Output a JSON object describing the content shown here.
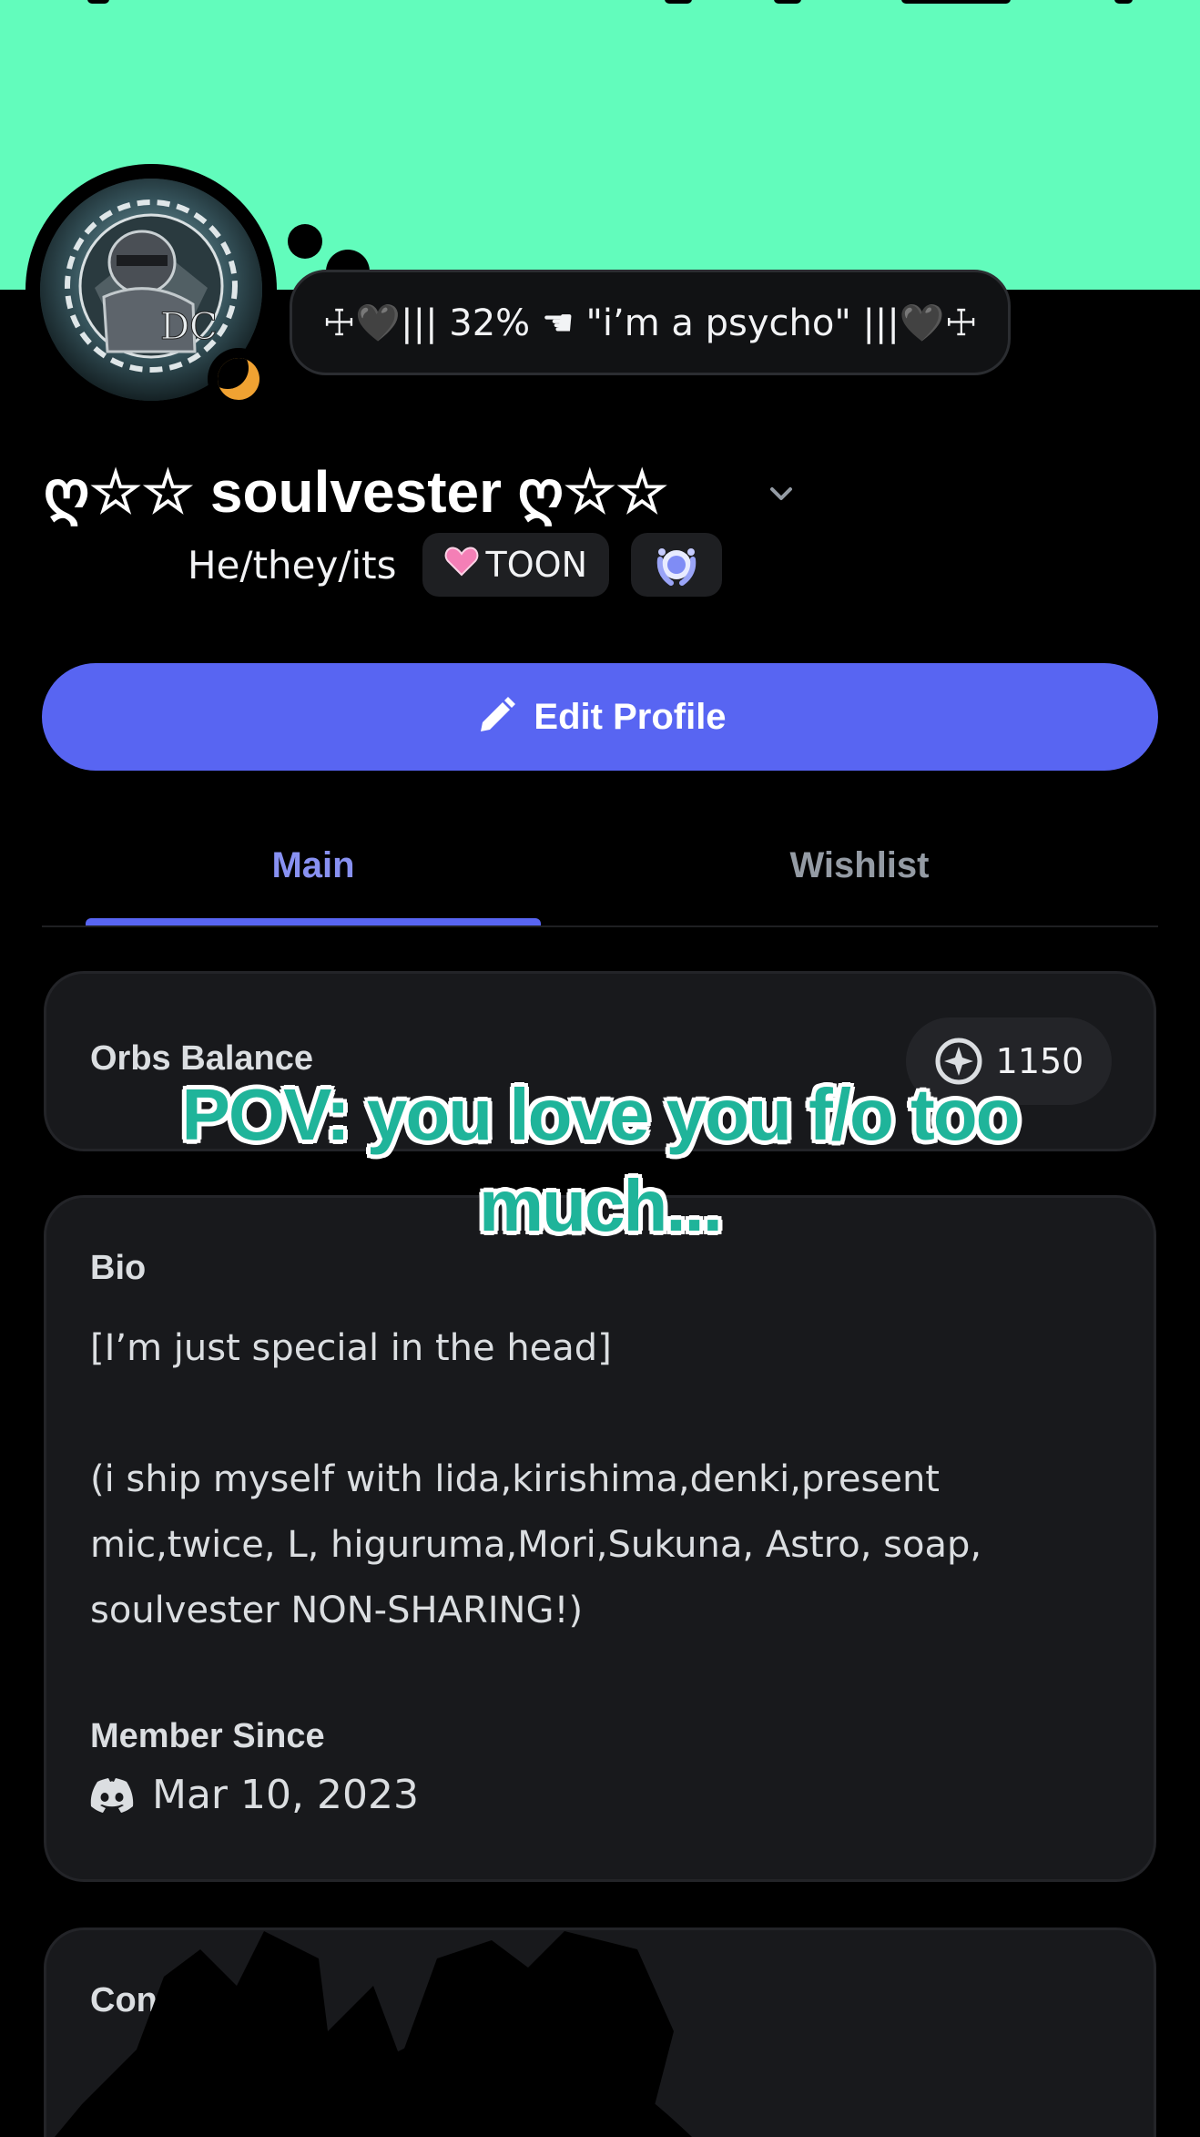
{
  "colors": {
    "banner": "#62fcbc",
    "accent": "#5865f2",
    "tab_active": "#8891f2",
    "caption_fill": "#1fb49a",
    "status_idle": "#f0a232"
  },
  "profile": {
    "status_text": "☩🖤|||  32% ☚ \"i’m a psycho\"  |||🖤☩",
    "display_name": "ღ☆☆ soulvester ღ☆☆",
    "pronouns": "He/they/its",
    "tag_label": "TOON",
    "tag_icon": "pink-heart-icon",
    "badge_icon": "laurel-badge-icon",
    "status": "idle-moon-icon"
  },
  "actions": {
    "edit_profile": "Edit Profile"
  },
  "tabs": [
    {
      "label": "Main",
      "active": true
    },
    {
      "label": "Wishlist",
      "active": false
    }
  ],
  "orbs": {
    "label": "Orbs Balance",
    "value": "1150"
  },
  "bio": {
    "heading": "Bio",
    "lines": [
      "[I’m just special in the head]",
      "(i ship myself with lida,kirishima,denki,present",
      "mic,twice, L, higuruma,Mori,Sukuna, Astro, soap,",
      "soulvester NON-SHARING!)"
    ]
  },
  "member_since": {
    "heading": "Member Since",
    "date": "Mar 10, 2023",
    "icon": "discord-icon"
  },
  "connections": {
    "heading": "Connect"
  },
  "overlay_caption": {
    "line1": "POV: you love you f/o too",
    "line2": "much..."
  }
}
